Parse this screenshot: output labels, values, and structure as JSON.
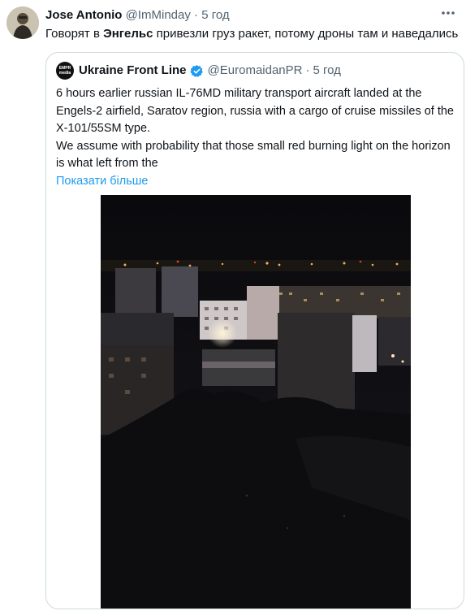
{
  "tweet": {
    "author_name": "Jose Antonio",
    "handle": "@ImMinday",
    "separator": "·",
    "time": "5 год",
    "text_before": "Говорят в ",
    "text_bold": "Энгельс",
    "text_after": " привезли груз ракет, потому дроны там и наведались",
    "more_icon": "more-horizontal-icon"
  },
  "quote": {
    "author_name": "Ukraine Front Line",
    "avatar_text_top": "EMPR",
    "avatar_text_bottom": "media",
    "handle": "@EuromaidanPR",
    "separator": "·",
    "time": "5 год",
    "paragraph_1": "6 hours earlier russian IL-76MD military transport aircraft landed at the Engels-2 airfield, Saratov region, russia with a cargo of cruise missiles of the X-101/55SM type.",
    "paragraph_2": "We assume with probability that those small red burning light on the horizon is what left from the",
    "show_more": "Показати більше",
    "verified_color": "#1d9bf0"
  }
}
